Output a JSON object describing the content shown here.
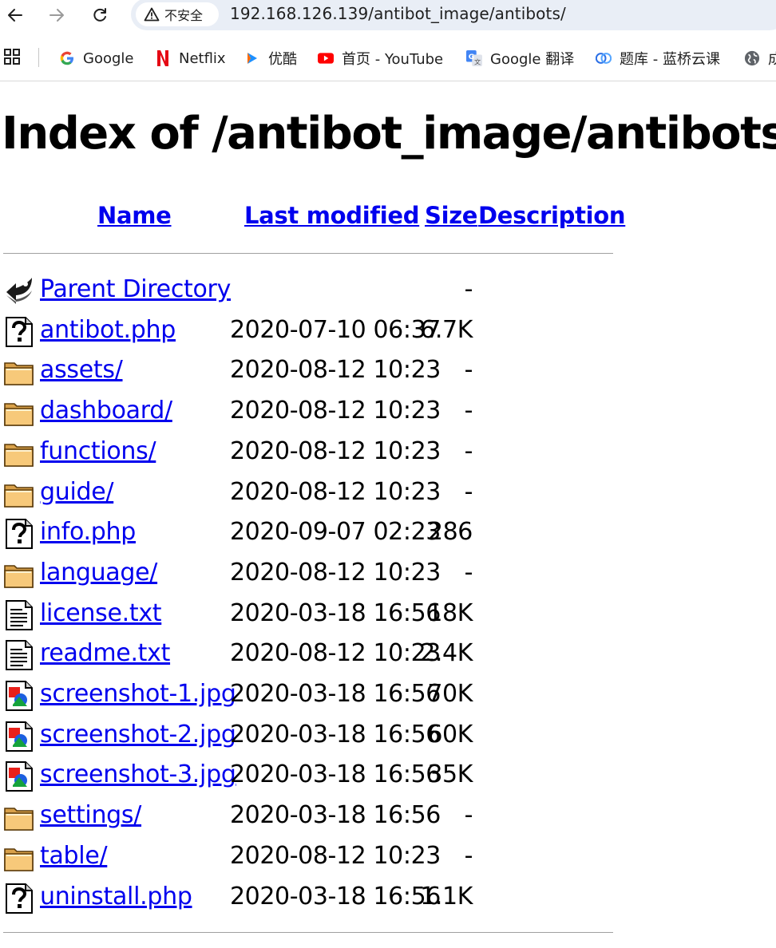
{
  "browser": {
    "security_label": "不安全",
    "url": "192.168.126.139/antibot_image/antibots/",
    "bookmarks": [
      {
        "label": "Google",
        "icon": "google-icon"
      },
      {
        "label": "Netflix",
        "icon": "netflix-icon"
      },
      {
        "label": "优酷",
        "icon": "youku-icon"
      },
      {
        "label": "首页 - YouTube",
        "icon": "youtube-icon"
      },
      {
        "label": "Google 翻译",
        "icon": "google-translate-icon"
      },
      {
        "label": "题库 - 蓝桥云课",
        "icon": "lanqiao-icon"
      },
      {
        "label": "成",
        "icon": "globe-icon"
      }
    ]
  },
  "page": {
    "title": "Index of /antibot_image/antibots",
    "columns": {
      "name": "Name",
      "last_modified": "Last modified",
      "size": "Size",
      "description": "Description"
    },
    "rows": [
      {
        "icon": "back-icon",
        "name": "Parent Directory",
        "date": "",
        "size": "-"
      },
      {
        "icon": "unknown-file-icon",
        "name": "antibot.php",
        "date": "2020-07-10 06:37",
        "size": "6.7K"
      },
      {
        "icon": "folder-icon",
        "name": "assets/",
        "date": "2020-08-12 10:23",
        "size": "-"
      },
      {
        "icon": "folder-icon",
        "name": "dashboard/",
        "date": "2020-08-12 10:23",
        "size": "-"
      },
      {
        "icon": "folder-icon",
        "name": "functions/",
        "date": "2020-08-12 10:23",
        "size": "-"
      },
      {
        "icon": "folder-icon",
        "name": "guide/",
        "date": "2020-08-12 10:23",
        "size": "-"
      },
      {
        "icon": "unknown-file-icon",
        "name": "info.php",
        "date": "2020-09-07 02:23",
        "size": "286"
      },
      {
        "icon": "folder-icon",
        "name": "language/",
        "date": "2020-08-12 10:23",
        "size": "-"
      },
      {
        "icon": "text-file-icon",
        "name": "license.txt",
        "date": "2020-03-18 16:56",
        "size": "18K"
      },
      {
        "icon": "text-file-icon",
        "name": "readme.txt",
        "date": "2020-08-12 10:23",
        "size": "2.4K"
      },
      {
        "icon": "image-file-icon",
        "name": "screenshot-1.jpg",
        "date": "2020-03-18 16:56",
        "size": "70K"
      },
      {
        "icon": "image-file-icon",
        "name": "screenshot-2.jpg",
        "date": "2020-03-18 16:56",
        "size": "60K"
      },
      {
        "icon": "image-file-icon",
        "name": "screenshot-3.jpg",
        "date": "2020-03-18 16:56",
        "size": "35K"
      },
      {
        "icon": "folder-icon",
        "name": "settings/",
        "date": "2020-03-18 16:56",
        "size": "-"
      },
      {
        "icon": "folder-icon",
        "name": "table/",
        "date": "2020-08-12 10:23",
        "size": "-"
      },
      {
        "icon": "unknown-file-icon",
        "name": "uninstall.php",
        "date": "2020-03-18 16:56",
        "size": "1.1K"
      }
    ]
  },
  "colors": {
    "link": "#0000ee",
    "omnibox": "#e9eef6"
  }
}
